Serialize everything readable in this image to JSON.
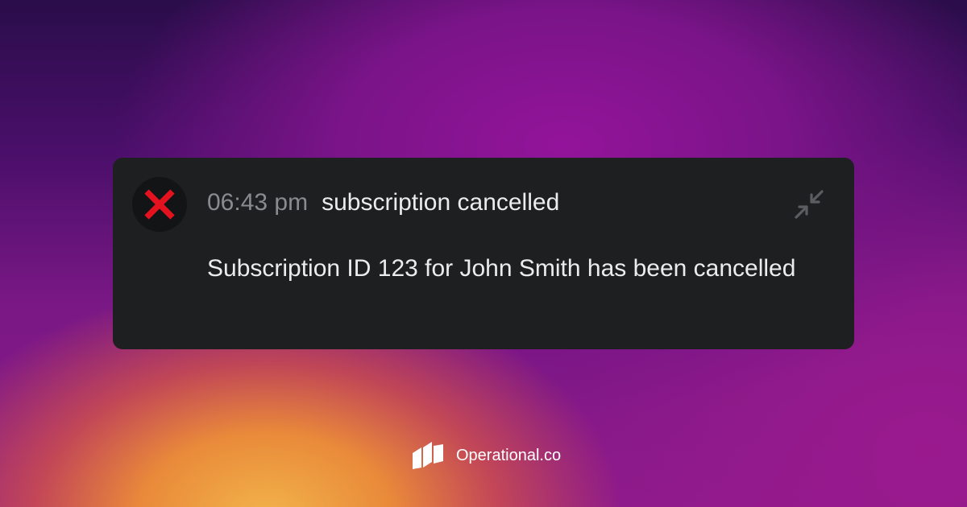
{
  "notification": {
    "status_icon": "red-cross-mark-icon",
    "time": "06:43 pm",
    "title": "subscription cancelled",
    "message": "Subscription ID 123 for John Smith has been cancelled",
    "collapse_icon": "collapse-arrows-icon"
  },
  "brand": {
    "logo_icon": "operational-logo-icon",
    "name": "Operational.co"
  },
  "colors": {
    "card_background": "#1e1f21",
    "error_red": "#e3121e",
    "muted_text": "#8a8b8e",
    "primary_text": "#ececee"
  }
}
